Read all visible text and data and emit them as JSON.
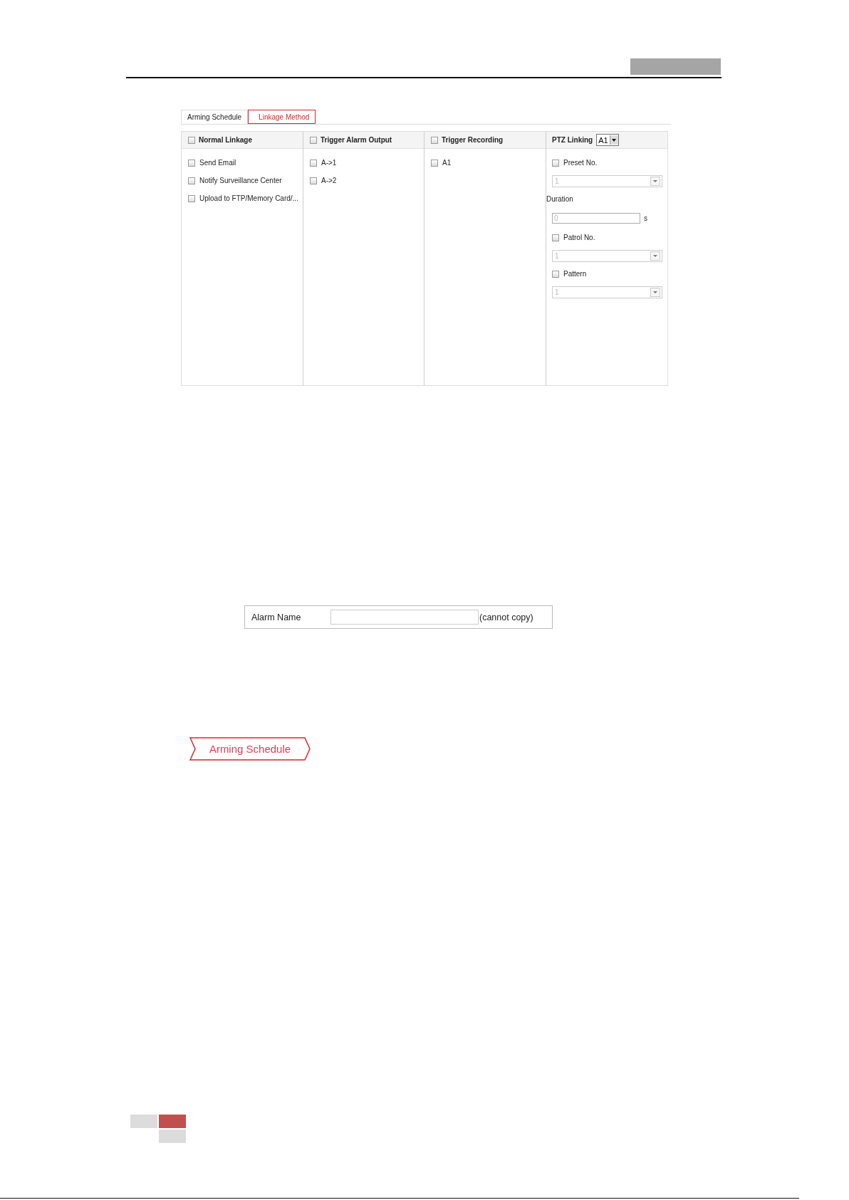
{
  "linkage_panel": {
    "tabs": [
      {
        "label": "Arming Schedule",
        "selected": false
      },
      {
        "label": "Linkage Method",
        "selected": true
      }
    ],
    "columns": [
      {
        "title": "Normal Linkage",
        "checked": false,
        "items": [
          {
            "kind": "checkbox",
            "label": "Send Email",
            "checked": false
          },
          {
            "kind": "checkbox",
            "label": "Notify Surveillance Center",
            "checked": false
          },
          {
            "kind": "checkbox",
            "label": "Upload to FTP/Memory Card/...",
            "checked": false
          }
        ]
      },
      {
        "title": "Trigger Alarm Output",
        "checked": false,
        "items": [
          {
            "kind": "checkbox",
            "label": "A->1",
            "checked": false
          },
          {
            "kind": "checkbox",
            "label": "A->2",
            "checked": false
          }
        ]
      },
      {
        "title": "Trigger Recording",
        "checked": false,
        "items": [
          {
            "kind": "checkbox",
            "label": "A1",
            "checked": false
          }
        ]
      },
      {
        "title": "PTZ Linking",
        "channel": "A1",
        "items": [
          {
            "kind": "checkbox",
            "label": "Preset No.",
            "checked": false
          },
          {
            "kind": "select",
            "value": "1",
            "disabled": true
          },
          {
            "kind": "label",
            "label": "Duration"
          },
          {
            "kind": "input",
            "value": "0",
            "unit": "s",
            "disabled": true
          },
          {
            "kind": "checkbox",
            "label": "Patrol No.",
            "checked": false
          },
          {
            "kind": "select",
            "value": "1",
            "disabled": true
          },
          {
            "kind": "checkbox",
            "label": "Pattern",
            "checked": false
          },
          {
            "kind": "select",
            "value": "1",
            "disabled": true
          }
        ]
      }
    ]
  },
  "alarm_name_panel": {
    "label": "Alarm Name",
    "note": "(cannot copy)"
  },
  "arming_schedule_tab": {
    "label": "Arming Schedule",
    "selected": true
  }
}
